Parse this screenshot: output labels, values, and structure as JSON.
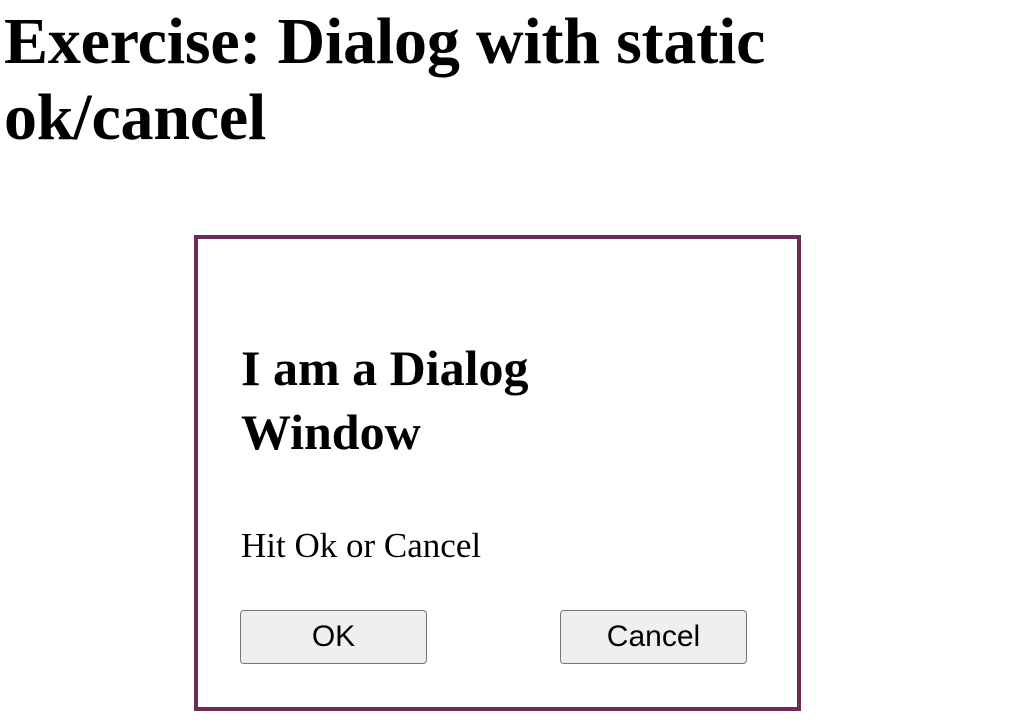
{
  "page": {
    "title": "Exercise: Dialog with static ok/cancel"
  },
  "dialog": {
    "title": "I am a Dialog Window",
    "message": "Hit Ok or Cancel",
    "ok_label": "OK",
    "cancel_label": "Cancel",
    "border_color": "#6b2c55"
  }
}
